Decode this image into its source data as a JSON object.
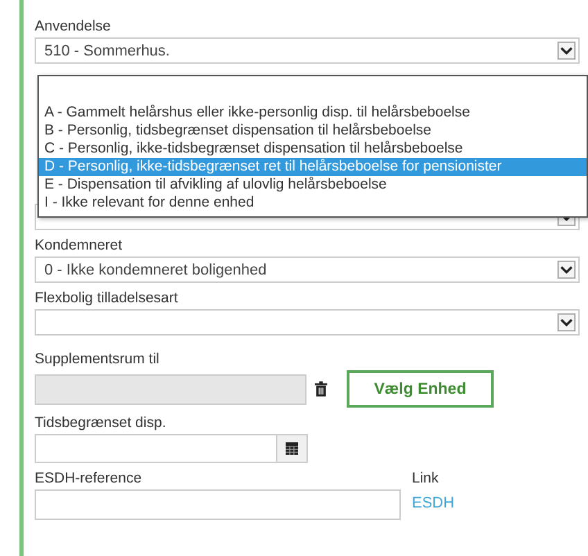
{
  "anvendelse": {
    "label": "Anvendelse",
    "value": "510 - Sommerhus."
  },
  "dropdown_list": {
    "options": [
      {
        "label": "A - Gammelt helårshus eller ikke-personlig disp. til helårsbeboelse",
        "selected": false
      },
      {
        "label": "B - Personlig, tidsbegrænset dispensation til helårsbeboelse",
        "selected": false
      },
      {
        "label": "C - Personlig, ikke-tidsbegrænset dispensation til helårsbeboelse",
        "selected": false
      },
      {
        "label": "D - Personlig, ikke-tidsbegrænset ret til helårsbeboelse for pensionister",
        "selected": true
      },
      {
        "label": "E - Dispensation til afvikling af ulovlig helårsbeboelse",
        "selected": false
      },
      {
        "label": "I - Ikke relevant for denne enhed",
        "selected": false
      }
    ]
  },
  "kondemneret": {
    "label": "Kondemneret",
    "value": "0 - Ikke kondemneret boligenhed"
  },
  "flexbolig": {
    "label": "Flexbolig tilladelsesart"
  },
  "supplementsrum": {
    "label": "Supplementsrum til",
    "disabled": true,
    "button": "Vælg Enhed"
  },
  "tidsbegraenset": {
    "label": "Tidsbegrænset disp."
  },
  "esdh": {
    "label": "ESDH-reference",
    "link_label": "Link",
    "link": "ESDH"
  }
}
